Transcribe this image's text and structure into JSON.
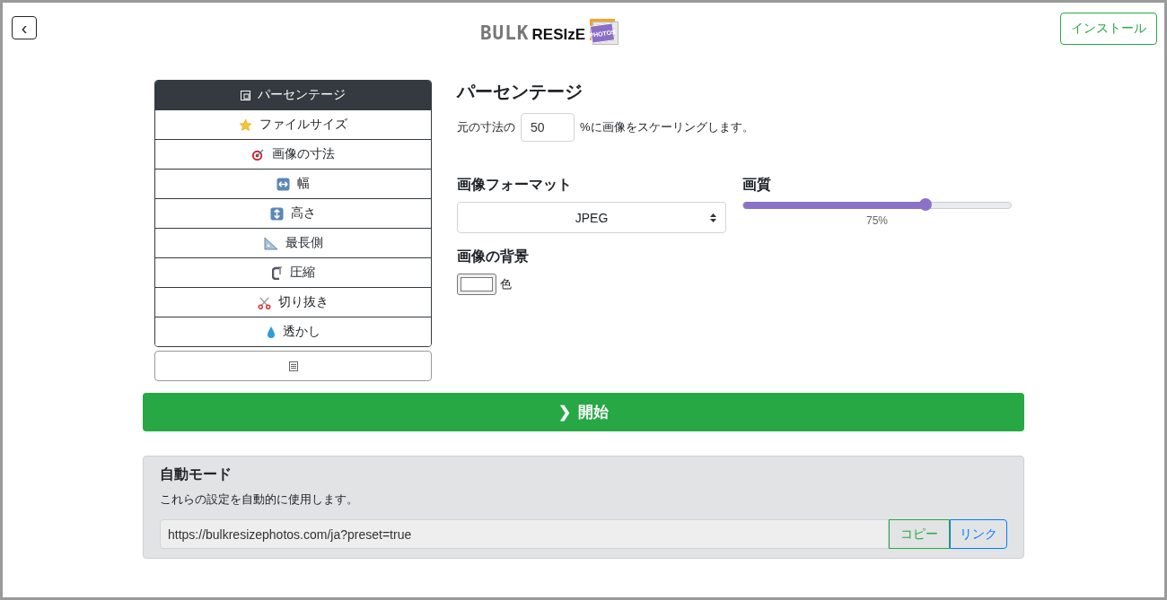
{
  "header": {
    "back_button": "‹",
    "logo": {
      "word_1": "BULK",
      "word_2": "RESIzE",
      "badge": "PHOTOS"
    },
    "install_button": "インストール"
  },
  "sidebar": {
    "items": [
      {
        "label": "パーセンテージ",
        "selected": true
      },
      {
        "label": "ファイルサイズ",
        "selected": false
      },
      {
        "label": "画像の寸法",
        "selected": false
      },
      {
        "label": "幅",
        "selected": false
      },
      {
        "label": "高さ",
        "selected": false
      },
      {
        "label": "最長側",
        "selected": false
      },
      {
        "label": "圧縮",
        "selected": false
      },
      {
        "label": "切り抜き",
        "selected": false
      },
      {
        "label": "透かし",
        "selected": false
      }
    ]
  },
  "panel": {
    "title": "パーセンテージ",
    "scale_prefix": "元の寸法の",
    "scale_value": "50",
    "scale_suffix": "%に画像をスケーリングします。",
    "format": {
      "label": "画像フォーマット",
      "value": "JPEG"
    },
    "quality": {
      "label": "画質",
      "level": 0.68,
      "reading": "75%"
    },
    "background": {
      "label": "画像の背景",
      "color_label": "色"
    }
  },
  "start_button": {
    "icon": "❯",
    "label": "開始"
  },
  "auto_mode": {
    "title": "自動モード",
    "description": "これらの設定を自動的に使用します。",
    "url": "https://bulkresizephotos.com/ja?preset=true",
    "copy_button": "コピー",
    "link_button": "リンク"
  }
}
